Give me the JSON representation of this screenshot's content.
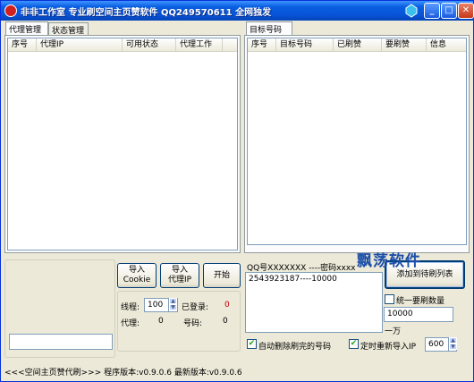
{
  "window": {
    "title": "非非工作室  专业刷空间主页赞软件 QQ249570611 全网独发"
  },
  "tabs_left": [
    {
      "label": "代理管理"
    },
    {
      "label": "状态管理"
    }
  ],
  "tab_right": {
    "label": "目标号码"
  },
  "proxy_table": {
    "columns": [
      "序号",
      "代理IP",
      "可用状态",
      "代理工作"
    ]
  },
  "target_table": {
    "columns": [
      "序号",
      "目标号码",
      "已刷赞",
      "要刷赞",
      "信息"
    ]
  },
  "buttons": {
    "import_cookie": "导入\nCookie",
    "import_proxy": "导入\n代理IP",
    "start": "开始",
    "add_to_list": "添加到待刷列表"
  },
  "stats": {
    "threads_label": "线程:",
    "threads_value": "100",
    "logged_label": "已登录:",
    "logged_value": "0",
    "proxy_label": "代理:",
    "proxy_value": "0",
    "number_label": "号码:",
    "number_value": "0"
  },
  "left_input": {
    "value": ""
  },
  "qq_input": {
    "header": "QQ号XXXXXXX ----密码xxxx",
    "value": "2543923187----10000"
  },
  "uniform": {
    "checkbox_label": "统一要刷数量",
    "value": "10000",
    "unit": "一万"
  },
  "options": {
    "auto_delete_label": "自动删除刷完的号码",
    "auto_delete_checked": "✔",
    "reimport_label": "定时重新导入IP",
    "reimport_checked": "✔",
    "reimport_value": "600"
  },
  "status_bar": "<<<空间主页赞代刷>>>  程序版本:v0.9.0.6 最新版本:v0.9.0.6",
  "watermark": "飘荡软件"
}
